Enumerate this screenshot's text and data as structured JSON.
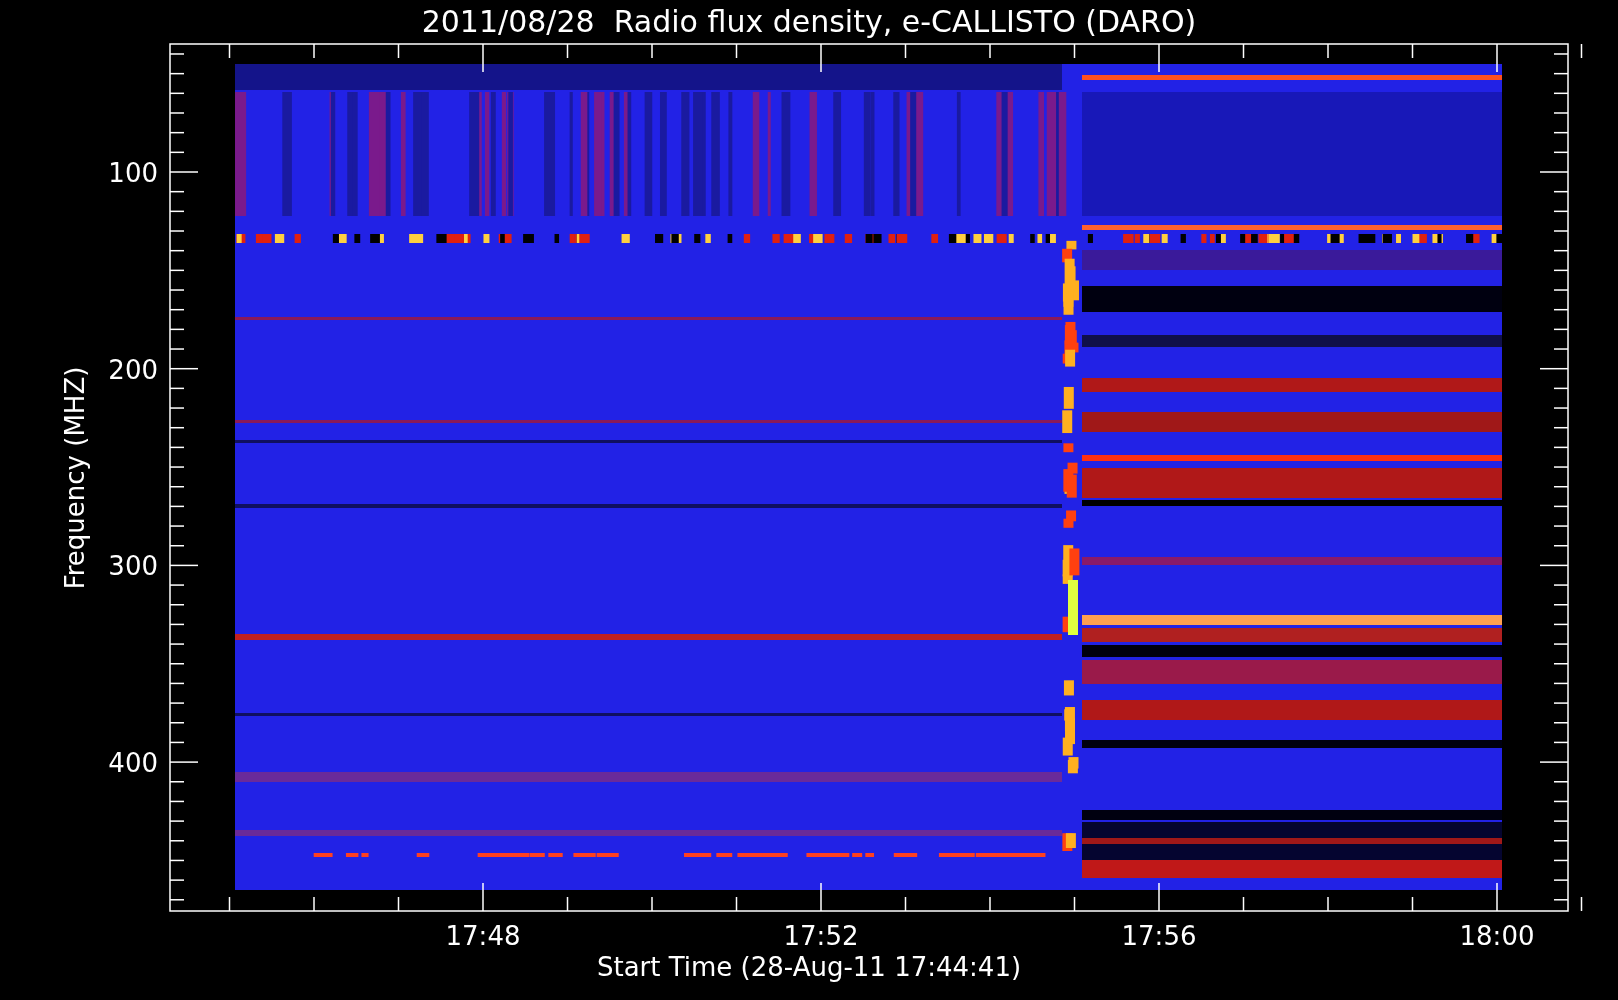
{
  "title": "2011/08/28  Radio flux density, e-CALLISTO (DARO)",
  "y_axis": {
    "label": "Frequency (MHZ)",
    "ticks": [
      "100",
      "200",
      "300",
      "400"
    ]
  },
  "x_axis": {
    "label": "Start Time (28-Aug-11 17:44:41)",
    "ticks": [
      "17:48",
      "17:52",
      "17:56",
      "18:00"
    ]
  }
}
